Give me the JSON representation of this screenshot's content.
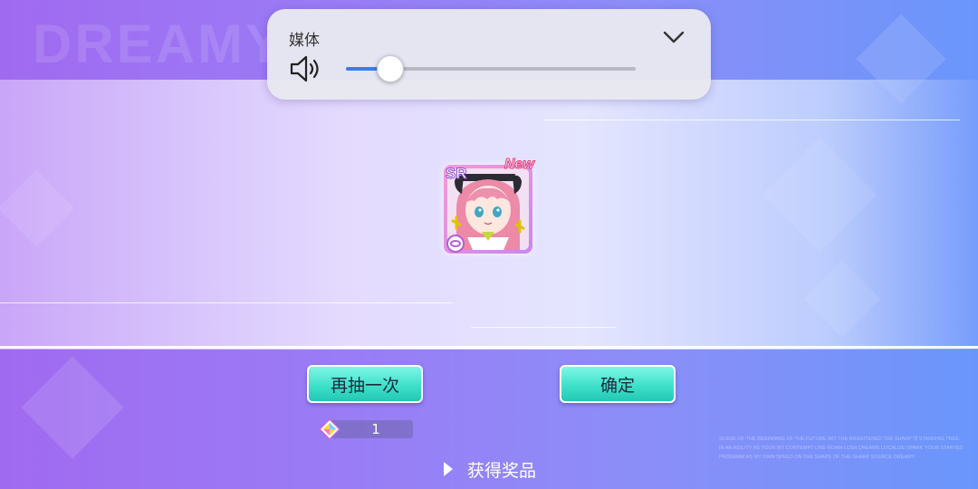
{
  "background": {
    "watermark_text": "DREAMY",
    "fine_print": "SCENE OF THE BEGINNING OF THE FUTURE WIT THE BRIGHTENED THE SHARP 의 STANDING TREE. IN AN AGILITY AS YOUR MY CONTEMPT LINE ROAM LUSH DREAMS LOCALIZE SPARK YOUR STARTED PROGRAM AS MY OWN SPEED ON THE SHAPE OF THE SHARP SOURCE DREAMY"
  },
  "volume_overlay": {
    "label": "媒体",
    "level": 0.15,
    "accent_color": "#3a7de8",
    "speaker_icon": "speaker-icon",
    "expand_icon": "chevron-down-icon"
  },
  "result_card": {
    "rarity": "SR",
    "badge": "New",
    "attribute_icon": "attribute-icon"
  },
  "buttons": {
    "redraw_label": "再抽一次",
    "confirm_label": "确定"
  },
  "cost": {
    "icon": "gem-icon",
    "value": "1"
  },
  "rewards_link": {
    "label": "获得奖品",
    "icon": "play-triangle-icon"
  }
}
